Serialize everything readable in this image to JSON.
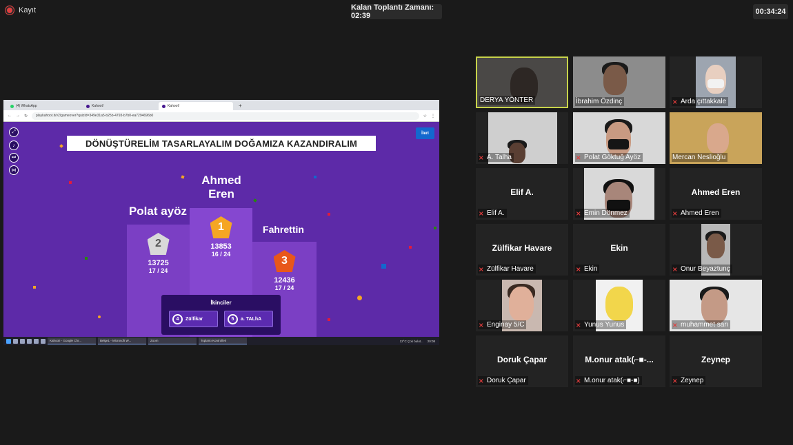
{
  "recording": {
    "label": "Kayıt"
  },
  "meeting_timer": {
    "text": "Kalan Toplantı Zamanı: 02:39"
  },
  "elapsed_timer": {
    "text": "00:34:24"
  },
  "shared_screen": {
    "tabs": [
      {
        "label": "(4) WhatsApp"
      },
      {
        "label": "Kahoot!"
      },
      {
        "label": "Kahoot!"
      }
    ],
    "url": "playkahoot.it/v2/gameover?quizId=349e31a5-b25b-4793-b7b0-ea7294696b0",
    "kahoot": {
      "title": "DÖNÜŞTÜRELİM TASARLAYALIM DOĞAMIZA KAZANDIRALIM",
      "next_label": "İleri",
      "first": {
        "name": "Ahmed\nEren",
        "rank": "1",
        "score": "13853",
        "fraction": "16 / 24"
      },
      "second": {
        "name": "Polat ayöz",
        "rank": "2",
        "score": "13725",
        "fraction": "17 / 24"
      },
      "third": {
        "name": "Fahrettin",
        "rank": "3",
        "score": "12436",
        "fraction": "17 / 24"
      },
      "runners_title": "İkinciler",
      "runners": [
        {
          "rank": "4",
          "name": "Zülfikar"
        },
        {
          "rank": "5",
          "name": "a. TALhA"
        }
      ]
    },
    "taskbar": {
      "apps": [
        "Kahoot! - Google Chr...",
        "Belge1 - Microsoft W...",
        "Zoom",
        "Toplantı Kontrolleri"
      ],
      "weather": "12°C Çok bulut...",
      "clock": "20:08"
    }
  },
  "participants": [
    {
      "name": "DERYA YÖNTER",
      "muted": false,
      "video": true,
      "active": true
    },
    {
      "name": "İbrahim Özdinç",
      "muted": false,
      "video": true
    },
    {
      "name": "Arda çıttakkale",
      "muted": true,
      "video": true
    },
    {
      "name": "A. Talha",
      "muted": true,
      "video": true
    },
    {
      "name": "Polat Göktuğ Ayöz",
      "muted": true,
      "video": true
    },
    {
      "name": "Mercan Neslioğlu",
      "muted": false,
      "video": true
    },
    {
      "name": "Elif A.",
      "display": "Elif A.",
      "muted": true,
      "video": false
    },
    {
      "name": "Emin Dönmez",
      "muted": true,
      "video": true
    },
    {
      "name": "Ahmed Eren",
      "display": "Ahmed Eren",
      "muted": true,
      "video": false
    },
    {
      "name": "Zülfikar Havare",
      "display": "Zülfikar Havare",
      "muted": true,
      "video": false
    },
    {
      "name": "Ekin",
      "display": "Ekin",
      "muted": true,
      "video": false
    },
    {
      "name": "Onur Beyaztunç",
      "muted": true,
      "video": true
    },
    {
      "name": "Enginay 5/C",
      "muted": true,
      "video": true
    },
    {
      "name": "Yunus Yunus",
      "muted": true,
      "video": true
    },
    {
      "name": "muhammet sarı",
      "muted": true,
      "video": true
    },
    {
      "name": "Doruk Çapar",
      "display": "Doruk Çapar",
      "muted": true,
      "video": false
    },
    {
      "name": "M.onur atak(⌐■-■)",
      "display": "M.onur atak(⌐■-...",
      "muted": true,
      "video": false
    },
    {
      "name": "Zeynep",
      "display": "Zeynep",
      "muted": true,
      "video": false
    }
  ]
}
